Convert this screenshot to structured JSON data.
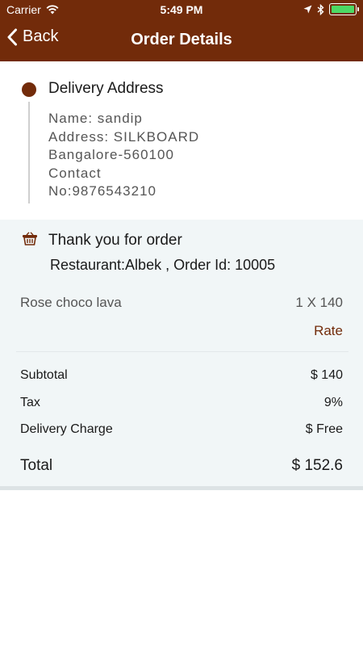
{
  "status_bar": {
    "carrier": "Carrier",
    "time": "5:49 PM",
    "battery_level": 1.0
  },
  "nav": {
    "back_label": "Back",
    "title": "Order Details"
  },
  "address": {
    "heading": "Delivery Address",
    "lines": [
      "Name: sandip",
      "Address: SILKBOARD",
      "Bangalore-560100",
      "Contact",
      "No:9876543210"
    ]
  },
  "order": {
    "thank_you": "Thank you for order",
    "restaurant_line": "Restaurant:Albek ,  Order Id: 10005",
    "items": [
      {
        "name": "Rose choco lava",
        "qty": "1 X 140"
      }
    ],
    "rate_label": "Rate",
    "summary": {
      "subtotal_label": "Subtotal",
      "subtotal_value": "$  140",
      "tax_label": "Tax",
      "tax_value": "9%",
      "delivery_label": "Delivery Charge",
      "delivery_value": "$  Free",
      "total_label": "Total",
      "total_value": "$  152.6"
    }
  },
  "colors": {
    "brand": "#722b0a",
    "order_background": "#f1f6f7",
    "battery_fill": "#4cd964"
  },
  "icons": {
    "signal": "wifi-icon",
    "location": "location-arrow-icon",
    "bluetooth": "bluetooth-icon",
    "battery": "battery-icon",
    "back": "chevron-left-icon",
    "address_marker": "dot-icon",
    "basket": "basket-icon"
  }
}
